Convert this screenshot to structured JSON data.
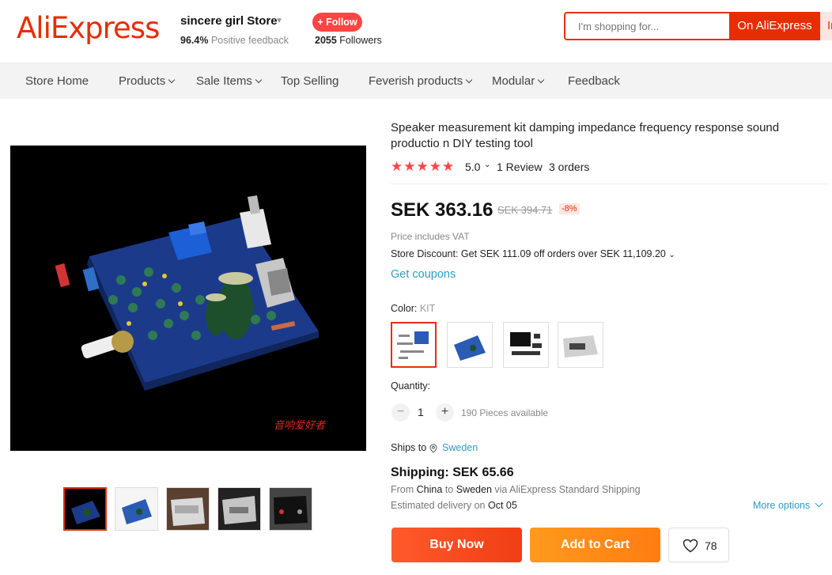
{
  "header": {
    "logo": "AliExpress",
    "store_name": "sincere girl Store",
    "feedback_pct": "96.4%",
    "feedback_label": "Positive feedback",
    "follow_label": "+ Follow",
    "followers_count": "2055",
    "followers_label": "Followers",
    "search_placeholder": "I'm shopping for...",
    "search_on": "On AliExpress",
    "search_in": "In"
  },
  "nav": {
    "items": [
      "Store Home",
      "Products",
      "Sale Items",
      "Top Selling",
      "Feverish products",
      "Modular",
      "Feedback"
    ]
  },
  "product": {
    "title": "Speaker measurement kit damping impedance frequency response sound productio n DIY testing tool",
    "rating": "5.0",
    "reviews": "1 Review",
    "orders": "3 orders",
    "price": "SEK 363.16",
    "orig_price": "SEK 394.71",
    "discount": "-8%",
    "vat": "Price includes VAT",
    "store_discount": "Store Discount: Get SEK 111.09 off orders over SEK 11,109.20",
    "coupons": "Get coupons",
    "color_label": "Color:",
    "color_value": "KIT",
    "quantity_label": "Quantity:",
    "quantity": "1",
    "available": "190 Pieces available",
    "ships_to_label": "Ships to",
    "ships_to_country": "Sweden",
    "shipping": "Shipping: SEK 65.66",
    "from_label": "From",
    "from_country": "China",
    "to_label": "to",
    "to_country": "Sweden",
    "via_text": "via AliExpress Standard Shipping",
    "delivery_label": "Estimated delivery on",
    "delivery_date": "Oct 05",
    "more_options": "More options",
    "buy_now": "Buy Now",
    "add_to_cart": "Add to Cart",
    "wishlist_count": "78",
    "watermark": "音响爱好者"
  },
  "colors": {
    "accent": "#e62e04",
    "link": "#2e9cc3",
    "buy": "#f44a1e",
    "cart": "#ff8a18"
  }
}
